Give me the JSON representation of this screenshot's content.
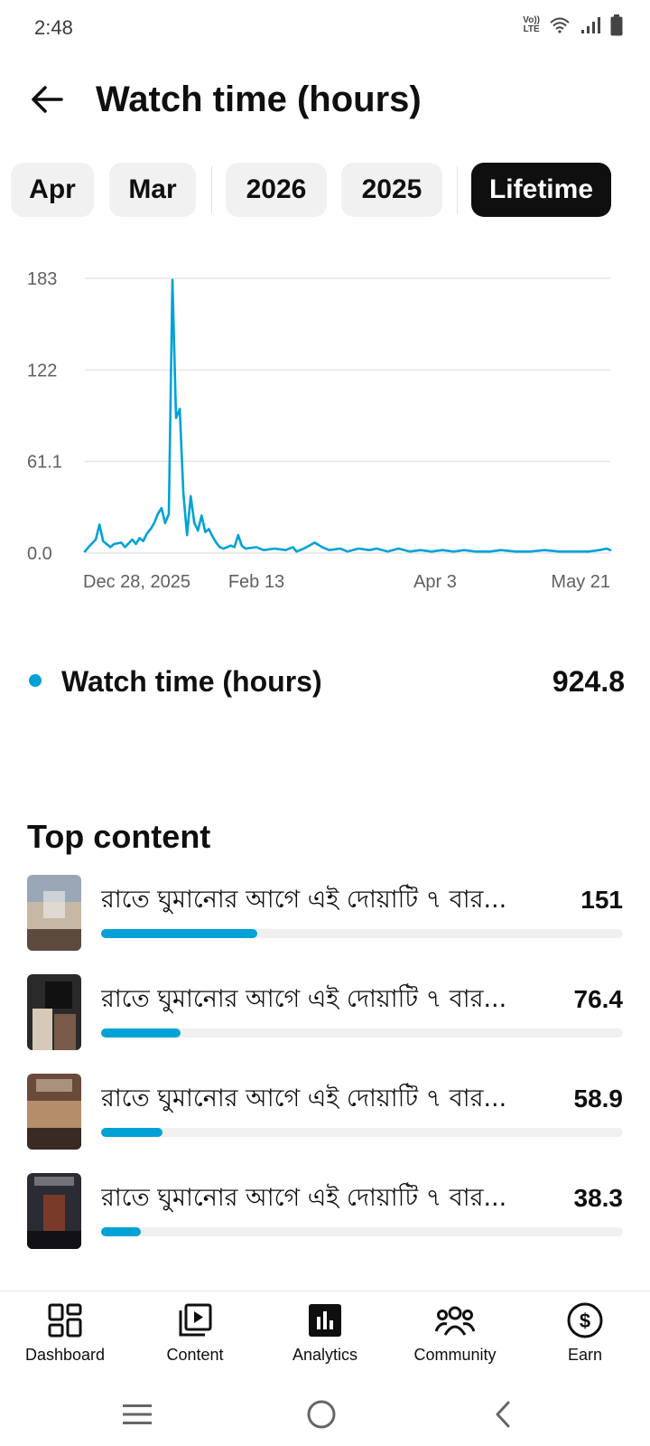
{
  "status_bar": {
    "time": "2:48",
    "volte_top": "Vo))",
    "volte_bottom": "LTE"
  },
  "header": {
    "title": "Watch time (hours)"
  },
  "period_chips": [
    {
      "label": "Apr",
      "selected": false
    },
    {
      "label": "Mar",
      "selected": false
    },
    {
      "label": "2026",
      "selected": false
    },
    {
      "label": "2025",
      "selected": false
    },
    {
      "label": "Lifetime",
      "selected": true
    }
  ],
  "chart_data": {
    "type": "line",
    "series_color": "#00a2d6",
    "y_ticks": [
      "183",
      "122",
      "61.1",
      "0.0"
    ],
    "ylim": [
      0,
      183
    ],
    "x_ticks": [
      "Dec 28, 2025",
      "Feb 13",
      "Apr 3",
      "May 21"
    ],
    "x_start": "2025-12-28",
    "x_end": "2026-05-21",
    "grid": true,
    "series": [
      {
        "name": "Watch time (hours)",
        "points": [
          [
            "2025-12-28",
            1
          ],
          [
            "2025-12-29",
            4
          ],
          [
            "2025-12-31",
            9
          ],
          [
            "2026-01-01",
            19
          ],
          [
            "2026-01-02",
            8
          ],
          [
            "2026-01-04",
            4
          ],
          [
            "2026-01-05",
            6
          ],
          [
            "2026-01-07",
            7
          ],
          [
            "2026-01-08",
            4
          ],
          [
            "2026-01-10",
            9
          ],
          [
            "2026-01-11",
            6
          ],
          [
            "2026-01-12",
            10
          ],
          [
            "2026-01-13",
            8
          ],
          [
            "2026-01-14",
            13
          ],
          [
            "2026-01-15",
            16
          ],
          [
            "2026-01-16",
            20
          ],
          [
            "2026-01-17",
            26
          ],
          [
            "2026-01-18",
            30
          ],
          [
            "2026-01-19",
            20
          ],
          [
            "2026-01-20",
            26
          ],
          [
            "2026-01-21",
            182
          ],
          [
            "2026-01-22",
            90
          ],
          [
            "2026-01-23",
            96
          ],
          [
            "2026-01-24",
            40
          ],
          [
            "2026-01-25",
            12
          ],
          [
            "2026-01-26",
            38
          ],
          [
            "2026-01-27",
            20
          ],
          [
            "2026-01-28",
            15
          ],
          [
            "2026-01-29",
            25
          ],
          [
            "2026-01-30",
            14
          ],
          [
            "2026-01-31",
            16
          ],
          [
            "2026-02-01",
            11
          ],
          [
            "2026-02-02",
            7
          ],
          [
            "2026-02-03",
            4
          ],
          [
            "2026-02-04",
            3
          ],
          [
            "2026-02-06",
            5
          ],
          [
            "2026-02-07",
            4
          ],
          [
            "2026-02-08",
            12
          ],
          [
            "2026-02-09",
            5
          ],
          [
            "2026-02-10",
            3
          ],
          [
            "2026-02-13",
            4
          ],
          [
            "2026-02-15",
            2
          ],
          [
            "2026-02-18",
            3
          ],
          [
            "2026-02-21",
            2
          ],
          [
            "2026-02-23",
            4
          ],
          [
            "2026-02-24",
            1
          ],
          [
            "2026-02-26",
            3
          ],
          [
            "2026-03-01",
            7
          ],
          [
            "2026-03-03",
            4
          ],
          [
            "2026-03-05",
            2
          ],
          [
            "2026-03-08",
            3
          ],
          [
            "2026-03-10",
            1
          ],
          [
            "2026-03-13",
            3
          ],
          [
            "2026-03-16",
            2
          ],
          [
            "2026-03-18",
            3
          ],
          [
            "2026-03-21",
            1
          ],
          [
            "2026-03-24",
            3
          ],
          [
            "2026-03-27",
            1
          ],
          [
            "2026-03-30",
            2
          ],
          [
            "2026-04-02",
            1
          ],
          [
            "2026-04-05",
            2
          ],
          [
            "2026-04-08",
            1
          ],
          [
            "2026-04-11",
            2
          ],
          [
            "2026-04-14",
            1
          ],
          [
            "2026-04-18",
            1
          ],
          [
            "2026-04-21",
            2
          ],
          [
            "2026-04-25",
            1
          ],
          [
            "2026-04-29",
            1
          ],
          [
            "2026-05-03",
            2
          ],
          [
            "2026-05-07",
            1
          ],
          [
            "2026-05-11",
            1
          ],
          [
            "2026-05-15",
            1
          ],
          [
            "2026-05-18",
            2
          ],
          [
            "2026-05-20",
            3
          ],
          [
            "2026-05-21",
            2
          ]
        ]
      }
    ]
  },
  "legend": {
    "label": "Watch time (hours)",
    "value": "924.8"
  },
  "top_content": {
    "title": "Top content",
    "max_value": 151,
    "items": [
      {
        "title": "রাতে ঘুমানোর আগে এই দোয়াটি ৭ বার...",
        "value": "151",
        "share": 1.0,
        "thumb_colors": [
          "#9aa7b6",
          "#c7b8a5",
          "#5c4a3f"
        ]
      },
      {
        "title": "রাতে ঘুমানোর আগে এই দোয়াটি ৭ বার...",
        "value": "76.4",
        "share": 0.506,
        "thumb_colors": [
          "#2a2a2a",
          "#d7c9b8",
          "#7a5a48"
        ]
      },
      {
        "title": "রাতে ঘুমানোর আগে এই দোয়াটি ৭ বার...",
        "value": "58.9",
        "share": 0.39,
        "thumb_colors": [
          "#6a4a3a",
          "#b58d6a",
          "#3a2a24"
        ]
      },
      {
        "title": "রাতে ঘুমানোর আগে এই দোয়াটি ৭ বার...",
        "value": "38.3",
        "share": 0.254,
        "thumb_colors": [
          "#2b2b34",
          "#7a3a2a",
          "#121216"
        ]
      }
    ]
  },
  "bottom_nav": [
    {
      "label": "Dashboard",
      "icon": "dashboard-icon"
    },
    {
      "label": "Content",
      "icon": "content-icon"
    },
    {
      "label": "Analytics",
      "icon": "analytics-icon",
      "selected": true
    },
    {
      "label": "Community",
      "icon": "community-icon"
    },
    {
      "label": "Earn",
      "icon": "earn-icon"
    }
  ],
  "system_nav": {
    "buttons": [
      "menu-icon",
      "home-icon",
      "back-chevron-icon"
    ]
  }
}
